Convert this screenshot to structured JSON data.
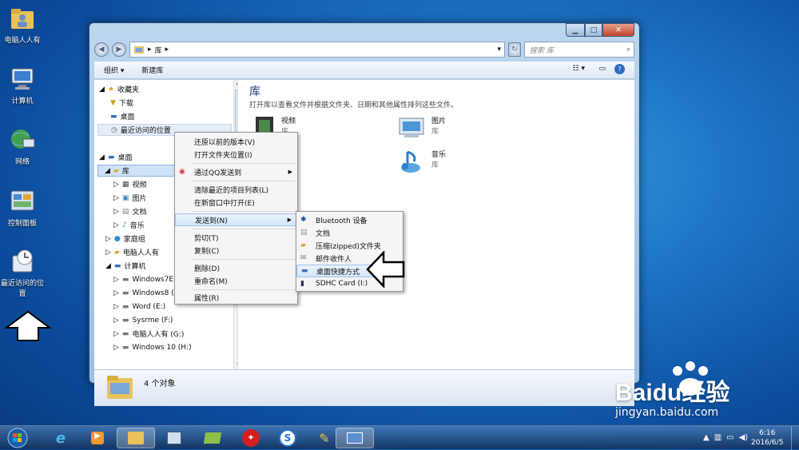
{
  "desktop": {
    "icons": [
      {
        "label": "电脑人人有",
        "icon": "user-folder-icon"
      },
      {
        "label": "计算机",
        "icon": "computer-icon"
      },
      {
        "label": "网络",
        "icon": "network-icon"
      },
      {
        "label": "控制面板",
        "icon": "control-panel-icon"
      },
      {
        "label": "最近访问的位置",
        "icon": "recent-places-icon"
      }
    ]
  },
  "window": {
    "breadcrumb": "库",
    "search_placeholder": "搜索 库",
    "toolbar": {
      "organize": "组织",
      "new_library": "新建库"
    },
    "nav": {
      "favorites": "收藏夹",
      "downloads": "下载",
      "desktop": "桌面",
      "recent": "最近访问的位置",
      "desktop_root": "桌面",
      "libraries": "库",
      "videos": "视频",
      "pictures": "图片",
      "documents": "文档",
      "music": "音乐",
      "homegroup": "家庭组",
      "user": "电脑人人有",
      "computer": "计算机",
      "drives": [
        "Windows7E (C",
        "Windows8 (D",
        "Word (E:)",
        "Sysrme (F:)",
        "电脑人人有 (G:)",
        "Windows 10 (H:)"
      ]
    },
    "content": {
      "title": "库",
      "description": "打开库以查看文件并根据文件夹、日期和其他属性排列这些文件。",
      "items": [
        {
          "name": "视频",
          "type": "库"
        },
        {
          "name": "图片",
          "type": "库"
        },
        {
          "name": "音乐",
          "type": "库"
        }
      ]
    },
    "status": "4 个对象"
  },
  "context_menu": {
    "items": [
      "还原以前的版本(V)",
      "打开文件夹位置(I)",
      "通过QQ发送到",
      "清除最近的项目列表(L)",
      "在新窗口中打开(E)",
      "发送到(N)",
      "剪切(T)",
      "复制(C)",
      "删除(D)",
      "重命名(M)",
      "属性(R)"
    ]
  },
  "sendto_menu": {
    "items": [
      "Bluetooth 设备",
      "文档",
      "压缩(zipped)文件夹",
      "邮件收件人",
      "桌面快捷方式",
      "SDHC Card (I:)"
    ]
  },
  "taskbar": {
    "time": "6:16",
    "date": "2016/6/5"
  },
  "watermark": {
    "text": "Baidu经验",
    "url": "jingyan.baidu.com"
  },
  "colors": {
    "accent": "#1d73c6",
    "highlight": "#d3e6f9"
  }
}
